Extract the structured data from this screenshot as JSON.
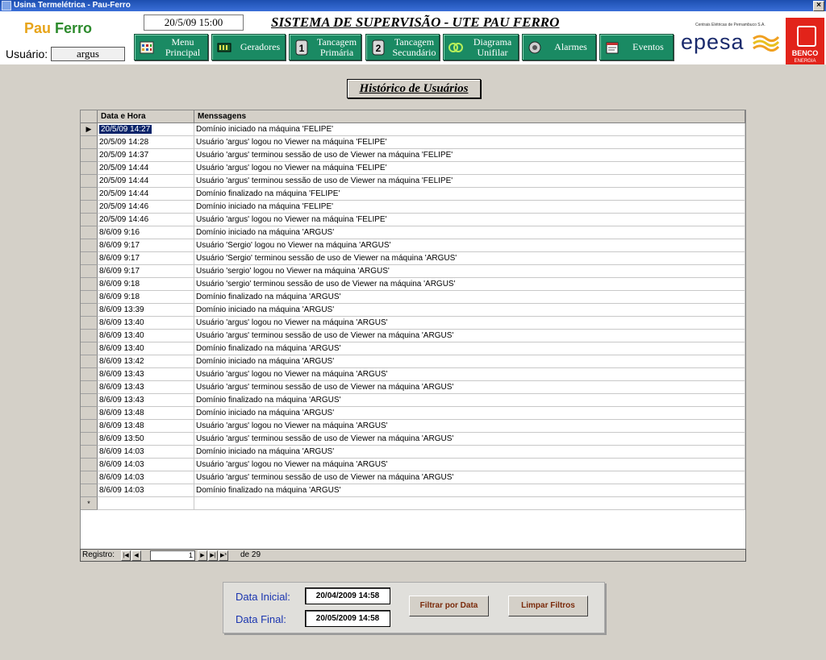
{
  "window": {
    "title": "Usina Termelétrica - Pau-Ferro",
    "close": "×"
  },
  "header": {
    "logo_part1": "Pau",
    "logo_part2": "Ferro",
    "user_label": "Usuário:",
    "user_value": "argus",
    "datetime": "20/5/09 15:00",
    "system_title": "SISTEMA DE SUPERVISÃO - UTE PAU FERRO",
    "nav": [
      {
        "line1": "Menu",
        "line2": "Principal",
        "icon": "grid-icon"
      },
      {
        "line1": "Geradores",
        "line2": "",
        "icon": "generator-icon"
      },
      {
        "line1": "Tancagem",
        "line2": "Primária",
        "icon": "tank-1-icon",
        "num": "1"
      },
      {
        "line1": "Tancagem",
        "line2": "Secundário",
        "icon": "tank-2-icon",
        "num": "2"
      },
      {
        "line1": "Diagrama",
        "line2": "Unifilar",
        "icon": "diagram-icon"
      },
      {
        "line1": "Alarmes",
        "line2": "",
        "icon": "alarm-icon"
      },
      {
        "line1": "Eventos",
        "line2": "",
        "icon": "events-icon"
      }
    ],
    "epesa_small": "Centrais Elétricas de Pernambuco S.A.",
    "epesa_big": "epesa",
    "benco": "BENCO",
    "benco_sub": "ENERGIA"
  },
  "page_title": "Histórico de Usuários",
  "grid": {
    "columns": [
      "Data e Hora",
      "Menssagens"
    ],
    "rows": [
      [
        "20/5/09 14:27",
        "Domínio iniciado na máquina 'FELIPE'"
      ],
      [
        "20/5/09 14:28",
        "Usuário 'argus' logou no Viewer na máquina 'FELIPE'"
      ],
      [
        "20/5/09 14:37",
        "Usuário 'argus' terminou sessão de uso de Viewer na máquina 'FELIPE'"
      ],
      [
        "20/5/09 14:44",
        "Usuário 'argus' logou no Viewer na máquina 'FELIPE'"
      ],
      [
        "20/5/09 14:44",
        "Usuário 'argus' terminou sessão de uso de Viewer na máquina 'FELIPE'"
      ],
      [
        "20/5/09 14:44",
        "Domínio finalizado na máquina 'FELIPE'"
      ],
      [
        "20/5/09 14:46",
        "Domínio iniciado na máquina 'FELIPE'"
      ],
      [
        "20/5/09 14:46",
        "Usuário 'argus' logou no Viewer na máquina 'FELIPE'"
      ],
      [
        "8/6/09 9:16",
        "Domínio iniciado na máquina 'ARGUS'"
      ],
      [
        "8/6/09 9:17",
        "Usuário 'Sergio' logou no Viewer na máquina 'ARGUS'"
      ],
      [
        "8/6/09 9:17",
        "Usuário 'Sergio' terminou sessão de uso de Viewer na máquina 'ARGUS'"
      ],
      [
        "8/6/09 9:17",
        "Usuário 'sergio' logou no Viewer na máquina 'ARGUS'"
      ],
      [
        "8/6/09 9:18",
        "Usuário 'sergio' terminou sessão de uso de Viewer na máquina 'ARGUS'"
      ],
      [
        "8/6/09 9:18",
        "Domínio finalizado na máquina 'ARGUS'"
      ],
      [
        "8/6/09 13:39",
        "Domínio iniciado na máquina 'ARGUS'"
      ],
      [
        "8/6/09 13:40",
        "Usuário 'argus' logou no Viewer na máquina 'ARGUS'"
      ],
      [
        "8/6/09 13:40",
        "Usuário 'argus' terminou sessão de uso de Viewer na máquina 'ARGUS'"
      ],
      [
        "8/6/09 13:40",
        "Domínio finalizado na máquina 'ARGUS'"
      ],
      [
        "8/6/09 13:42",
        "Domínio iniciado na máquina 'ARGUS'"
      ],
      [
        "8/6/09 13:43",
        "Usuário 'argus' logou no Viewer na máquina 'ARGUS'"
      ],
      [
        "8/6/09 13:43",
        "Usuário 'argus' terminou sessão de uso de Viewer na máquina 'ARGUS'"
      ],
      [
        "8/6/09 13:43",
        "Domínio finalizado na máquina 'ARGUS'"
      ],
      [
        "8/6/09 13:48",
        "Domínio iniciado na máquina 'ARGUS'"
      ],
      [
        "8/6/09 13:48",
        "Usuário 'argus' logou no Viewer na máquina 'ARGUS'"
      ],
      [
        "8/6/09 13:50",
        "Usuário 'argus' terminou sessão de uso de Viewer na máquina 'ARGUS'"
      ],
      [
        "8/6/09 14:03",
        "Domínio iniciado na máquina 'ARGUS'"
      ],
      [
        "8/6/09 14:03",
        "Usuário 'argus' logou no Viewer na máquina 'ARGUS'"
      ],
      [
        "8/6/09 14:03",
        "Usuário 'argus' terminou sessão de uso de Viewer na máquina 'ARGUS'"
      ],
      [
        "8/6/09 14:03",
        "Domínio finalizado na máquina 'ARGUS'"
      ]
    ],
    "current_row_marker": "▶",
    "new_row_marker": "*"
  },
  "record_nav": {
    "label": "Registro:",
    "current": "1",
    "total_text": "de 29",
    "first": "|◀",
    "prev": "◀",
    "next": "▶",
    "last": "▶|",
    "new": "▶*"
  },
  "filter": {
    "start_label": "Data Inicial:",
    "start_value": "20/04/2009   14:58",
    "end_label": "Data Final:",
    "end_value": "20/05/2009   14:58",
    "filter_button": "Filtrar por Data",
    "clear_button": "Limpar Filtros"
  }
}
